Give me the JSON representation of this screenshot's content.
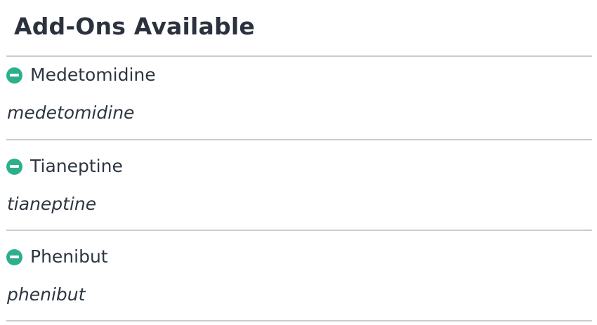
{
  "header": {
    "title": "Add-Ons Available"
  },
  "addons": [
    {
      "name": "Medetomidine",
      "generic": "medetomidine",
      "icon": "minus-circle-icon"
    },
    {
      "name": "Tianeptine",
      "generic": "tianeptine",
      "icon": "minus-circle-icon"
    },
    {
      "name": "Phenibut",
      "generic": "phenibut",
      "icon": "minus-circle-icon"
    }
  ],
  "colors": {
    "accent": "#2daf8c",
    "text": "#2d3641",
    "divider": "#cccccc"
  }
}
